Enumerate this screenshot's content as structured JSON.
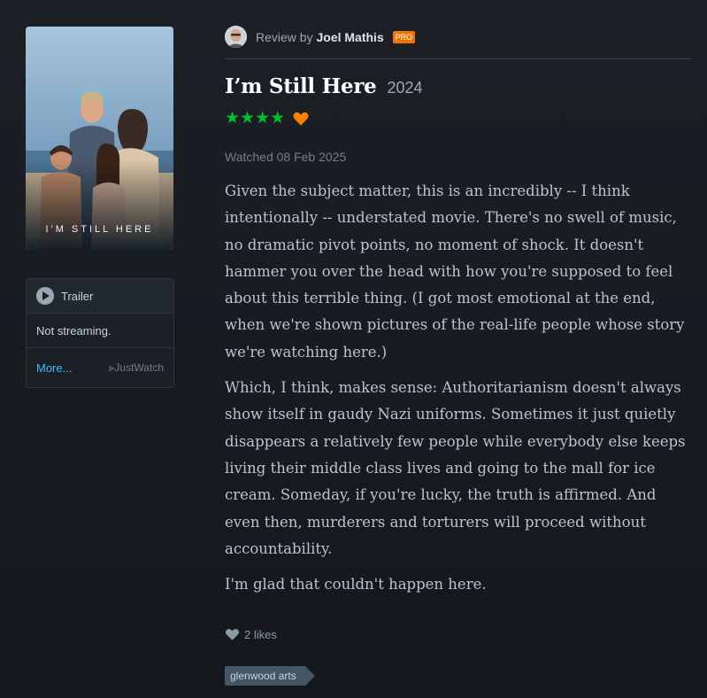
{
  "poster": {
    "title_text": "I'M STILL HERE"
  },
  "watch_panel": {
    "trailer_label": "Trailer",
    "streaming_status": "Not streaming.",
    "more_link": "More...",
    "provider": "JustWatch",
    "provider_icon": "justwatch-play-glyph"
  },
  "review": {
    "by_prefix": "Review by",
    "reviewer": "Joel Mathis",
    "badge": "PRO",
    "film_title": "I’m Still Here",
    "year": "2024",
    "rating_stars": "★★★★",
    "rating_value": 4,
    "liked": true,
    "watched": "Watched 08 Feb 2025",
    "paragraphs": [
      "Given the subject matter, this is an incredibly -- I think intentionally -- understated movie. There's no swell of music, no dramatic pivot points, no moment of shock. It doesn't hammer you over the head with how you're supposed to feel about this terrible thing. (I got most emotional at the end, when we're shown pictures of the real-life people whose story we're watching here.)",
      "Which, I think, makes sense: Authoritarianism doesn't always show itself in gaudy Nazi uniforms. Sometimes it just quietly disappears a relatively few people while everybody else keeps living their middle class lives and going to the mall for ice cream. Someday, if you're lucky, the truth is affirmed. And even then, murderers and torturers will proceed without accountability.",
      "I'm glad that couldn't happen here."
    ],
    "likes": "2 likes",
    "tag": "glenwood arts"
  },
  "colors": {
    "background": "#14181c",
    "star_green": "#00c030",
    "heart_orange": "#ff8000",
    "link_blue": "#40bcf4",
    "pro_orange": "#f27405"
  }
}
